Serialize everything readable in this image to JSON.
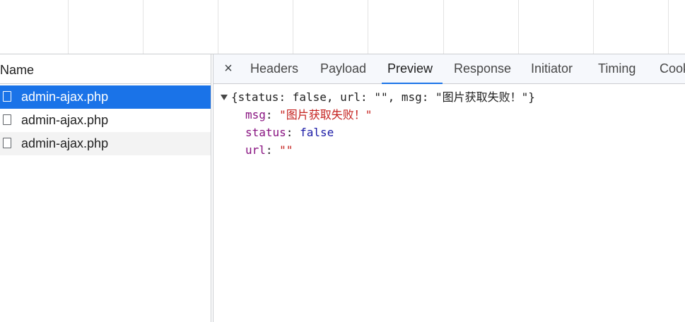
{
  "request_list": {
    "header": "Name",
    "requests": [
      {
        "name": "admin-ajax.php",
        "selected": true
      },
      {
        "name": "admin-ajax.php",
        "selected": false
      },
      {
        "name": "admin-ajax.php",
        "selected": false
      }
    ]
  },
  "detail": {
    "close_icon": "close-icon",
    "close_glyph": "×",
    "tabs": [
      "Headers",
      "Payload",
      "Preview",
      "Response",
      "Initiator",
      "Timing",
      "Cookies"
    ],
    "active_tab": "Preview"
  },
  "preview": {
    "summary": {
      "open": "{",
      "status_key": "status",
      "status_value": "false",
      "url_key": "url",
      "url_value": "\"\"",
      "msg_key": "msg",
      "msg_value": "\"图片获取失败！\"",
      "close": "}"
    },
    "fields": [
      {
        "key": "msg",
        "value": "\"图片获取失败！\"",
        "type": "string"
      },
      {
        "key": "status",
        "value": "false",
        "type": "boolean"
      },
      {
        "key": "url",
        "value": "\"\"",
        "type": "string"
      }
    ]
  },
  "colors": {
    "selected_row": "#1a73e8",
    "json_key": "#881280",
    "json_string": "#c5221f",
    "json_boolean": "#1a1aa6"
  }
}
